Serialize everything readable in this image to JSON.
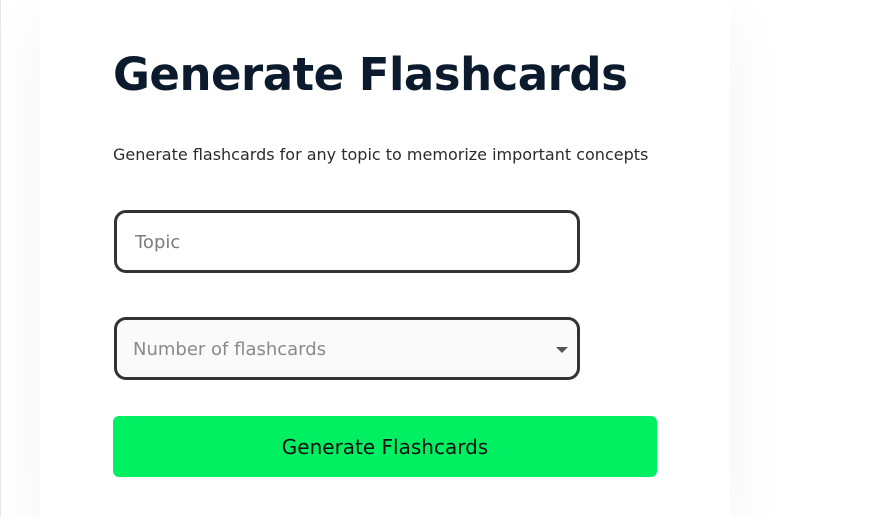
{
  "page": {
    "title": "Generate Flashcards",
    "subtitle": "Generate flashcards for any topic to memorize important concepts"
  },
  "form": {
    "topic": {
      "placeholder": "Topic",
      "value": ""
    },
    "count": {
      "placeholder": "Number of flashcards",
      "icon": "chevron-down-icon"
    },
    "submit_label": "Generate Flashcards"
  },
  "colors": {
    "accent": "#00f062",
    "title": "#0b1a2c",
    "field_border": "#333333"
  }
}
